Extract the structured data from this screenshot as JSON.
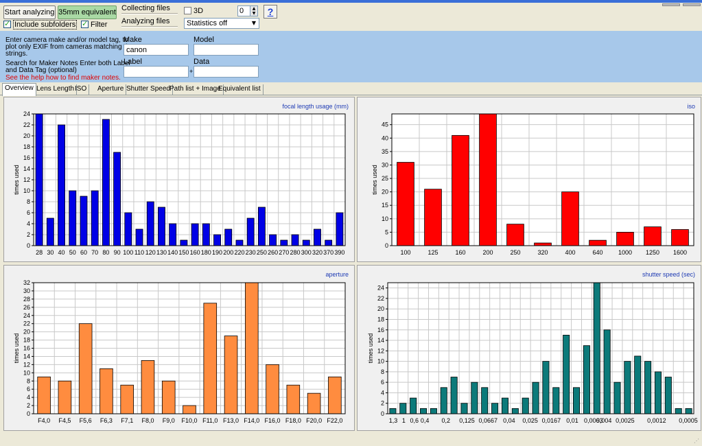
{
  "toolbar": {
    "start_label": "Start analyzing",
    "equiv_label": "35mm equivalent",
    "include_subfolders_label": "Include subfolders",
    "include_subfolders_checked": true,
    "filter_label": "Filter",
    "filter_checked": true,
    "collecting_label": "Collecting files",
    "analyzing_label": "Analyzing files",
    "three_d_label": "3D",
    "three_d_checked": false,
    "spin_value": "0",
    "statistics_value": "Statistics off",
    "help_label": "?"
  },
  "filter_panel": {
    "instructions": [
      "Enter camera make and/or model tag, to",
      "plot only EXIF from cameras matching these",
      "strings.",
      "Search for Maker Notes Enter both Label",
      "and Data Tag (optional)"
    ],
    "help_link": "See the help how to find maker notes.",
    "make_label": "Make",
    "make_value": "canon",
    "model_label": "Model",
    "model_value": "",
    "label_label": "Label",
    "label_value": "",
    "data_label": "Data",
    "data_value": "",
    "plus": "+"
  },
  "tabs": [
    {
      "label": "Overview",
      "active": true
    },
    {
      "label": "Lens Length",
      "active": false
    },
    {
      "label": "ISO",
      "active": false
    },
    {
      "label": "Aperture",
      "active": false
    },
    {
      "label": "Shutter Speed",
      "active": false
    },
    {
      "label": "Path list + Image",
      "active": false
    },
    {
      "label": "Equivalent list",
      "active": false
    }
  ],
  "chart_data": [
    {
      "type": "bar",
      "title": "focal length usage (mm)",
      "ylabel": "times used",
      "color": "#0000e6",
      "ylim": [
        0,
        24
      ],
      "ytick_step": 2,
      "categories": [
        "28",
        "30",
        "40",
        "50",
        "60",
        "70",
        "80",
        "90",
        "100",
        "110",
        "120",
        "130",
        "140",
        "150",
        "160",
        "180",
        "190",
        "200",
        "220",
        "230",
        "250",
        "260",
        "270",
        "280",
        "300",
        "320",
        "370",
        "390"
      ],
      "values": [
        24,
        5,
        22,
        10,
        9,
        10,
        23,
        17,
        6,
        3,
        8,
        7,
        4,
        1,
        4,
        4,
        2,
        3,
        1,
        5,
        7,
        2,
        1,
        2,
        1,
        3,
        1,
        6
      ]
    },
    {
      "type": "bar",
      "title": "iso",
      "ylabel": "times used",
      "color": "#ff0000",
      "ylim": [
        0,
        49
      ],
      "ytick_step": 5,
      "categories": [
        "100",
        "125",
        "160",
        "200",
        "250",
        "320",
        "400",
        "640",
        "1000",
        "1250",
        "1600"
      ],
      "values": [
        31,
        21,
        41,
        49,
        8,
        1,
        20,
        2,
        5,
        7,
        6
      ]
    },
    {
      "type": "bar",
      "title": "aperture",
      "ylabel": "times used",
      "color": "#ff8c3f",
      "ylim": [
        0,
        32
      ],
      "ytick_step": 2,
      "categories": [
        "F4,0",
        "F4,5",
        "F5,6",
        "F6,3",
        "F7,1",
        "F8,0",
        "F9,0",
        "F10,0",
        "F11,0",
        "F13,0",
        "F14,0",
        "F16,0",
        "F18,0",
        "F20,0",
        "F22,0"
      ],
      "values": [
        9,
        8,
        22,
        11,
        7,
        13,
        8,
        2,
        27,
        19,
        32,
        12,
        7,
        5,
        9
      ]
    },
    {
      "type": "bar",
      "title": "shutter speed (sec)",
      "ylabel": "times used",
      "color": "#0c7a7a",
      "ylim": [
        0,
        25
      ],
      "ytick_step": 2,
      "ytick_max": 24,
      "categories": [
        "1,3",
        "1",
        "0,6",
        "0,4",
        "",
        "0,2",
        "",
        "0,125",
        "",
        "0,0667",
        "",
        "0,04",
        "",
        "0,025",
        "",
        "0,0167",
        "",
        "0,01",
        "",
        "0,0063",
        "0,004",
        "",
        "0,0025",
        "",
        "",
        "0,0012",
        "",
        "",
        "0,0005"
      ],
      "labels_on_first_only": false,
      "values": [
        1,
        2,
        3,
        1,
        1,
        5,
        7,
        2,
        6,
        5,
        2,
        3,
        1,
        3,
        6,
        10,
        5,
        15,
        5,
        13,
        25,
        16,
        6,
        10,
        11,
        10,
        8,
        7,
        1,
        1
      ]
    }
  ]
}
